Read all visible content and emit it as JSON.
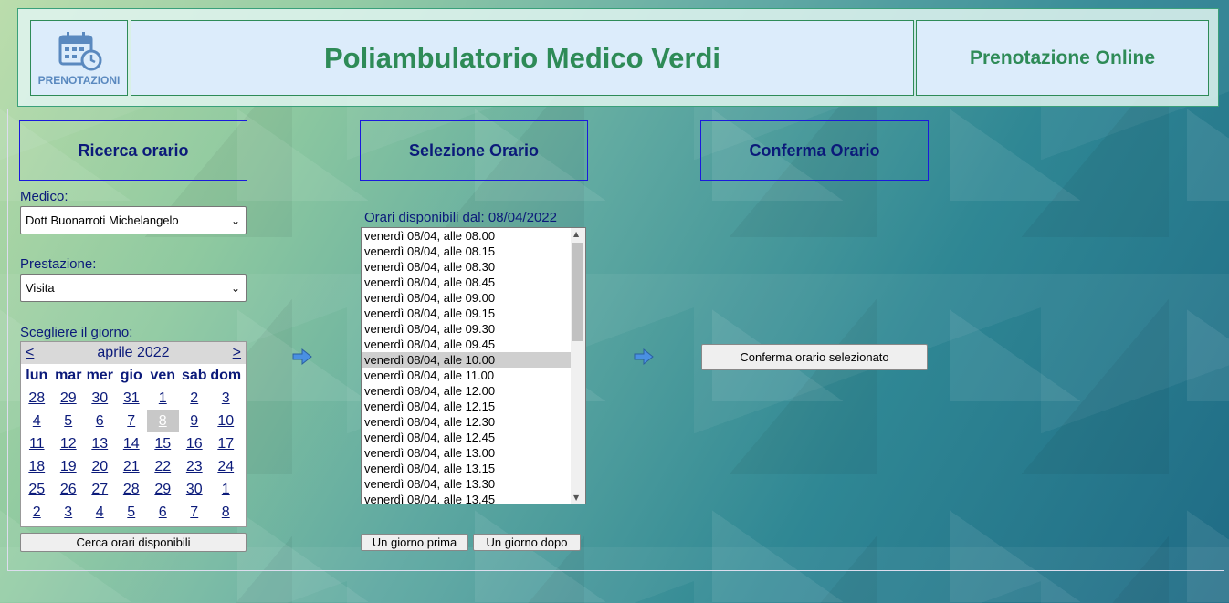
{
  "header": {
    "logo_label": "PRENOTAZIONI",
    "title": "Poliambulatorio Medico Verdi",
    "subtitle": "Prenotazione Online"
  },
  "steps": {
    "search": "Ricerca orario",
    "select": "Selezione Orario",
    "confirm": "Conferma Orario"
  },
  "form": {
    "doctor_label": "Medico:",
    "doctor_value": "Dott Buonarroti Michelangelo",
    "service_label": "Prestazione:",
    "service_value": "Visita",
    "day_label": "Scegliere il giorno:"
  },
  "calendar": {
    "prev": "<",
    "next": ">",
    "month": "aprile 2022",
    "weekdays": [
      "lun",
      "mar",
      "mer",
      "gio",
      "ven",
      "sab",
      "dom"
    ],
    "weeks": [
      [
        "28",
        "29",
        "30",
        "31",
        "1",
        "2",
        "3"
      ],
      [
        "4",
        "5",
        "6",
        "7",
        "8",
        "9",
        "10"
      ],
      [
        "11",
        "12",
        "13",
        "14",
        "15",
        "16",
        "17"
      ],
      [
        "18",
        "19",
        "20",
        "21",
        "22",
        "23",
        "24"
      ],
      [
        "25",
        "26",
        "27",
        "28",
        "29",
        "30",
        "1"
      ],
      [
        "2",
        "3",
        "4",
        "5",
        "6",
        "7",
        "8"
      ]
    ],
    "selected_day": "8"
  },
  "search_button": "Cerca orari disponibili",
  "slots": {
    "label": "Orari disponibili dal: 08/04/2022",
    "items": [
      "venerdì 08/04, alle 08.00",
      "venerdì 08/04, alle 08.15",
      "venerdì 08/04, alle 08.30",
      "venerdì 08/04, alle 08.45",
      "venerdì 08/04, alle 09.00",
      "venerdì 08/04, alle 09.15",
      "venerdì 08/04, alle 09.30",
      "venerdì 08/04, alle 09.45",
      "venerdì 08/04, alle 10.00",
      "venerdì 08/04, alle 11.00",
      "venerdì 08/04, alle 12.00",
      "venerdì 08/04, alle 12.15",
      "venerdì 08/04, alle 12.30",
      "venerdì 08/04, alle 12.45",
      "venerdì 08/04, alle 13.00",
      "venerdì 08/04, alle 13.15",
      "venerdì 08/04, alle 13.30",
      "venerdì 08/04, alle 13.45"
    ],
    "selected_index": 8
  },
  "nav_buttons": {
    "prev_day": "Un giorno prima",
    "next_day": "Un giorno dopo"
  },
  "confirm_button": "Conferma orario selezionato"
}
